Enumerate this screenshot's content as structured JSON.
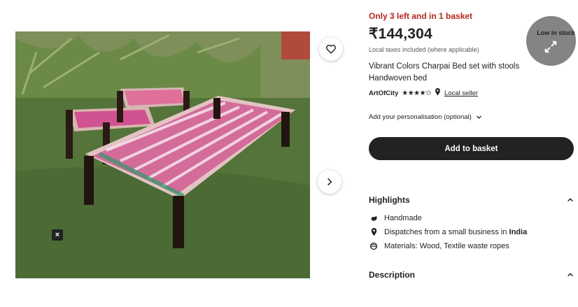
{
  "stock_notice": "Only 3 left and in 1 basket",
  "price": "₹144,304",
  "tax_note": "Local taxes included (where applicable)",
  "title": "Vibrant Colors Charpai Bed set with stools Handwoven bed",
  "seller": {
    "name": "ArtOfCity",
    "rating_stars": "★★★★✩",
    "local_seller_label": "Local seller"
  },
  "personalisation_label": "Add your personalisation (optional)",
  "add_to_basket_label": "Add to basket",
  "highlights": {
    "heading": "Highlights",
    "items": [
      {
        "icon": "hand-icon",
        "text": "Handmade"
      },
      {
        "icon": "location-pin-icon",
        "text_prefix": "Dispatches from a small business in ",
        "text_bold": "India"
      },
      {
        "icon": "yarn-icon",
        "text": "Materials: Wood, Textile waste ropes"
      }
    ]
  },
  "description_heading": "Description",
  "low_stock_badge": "Low in stock",
  "image_close": "×"
}
